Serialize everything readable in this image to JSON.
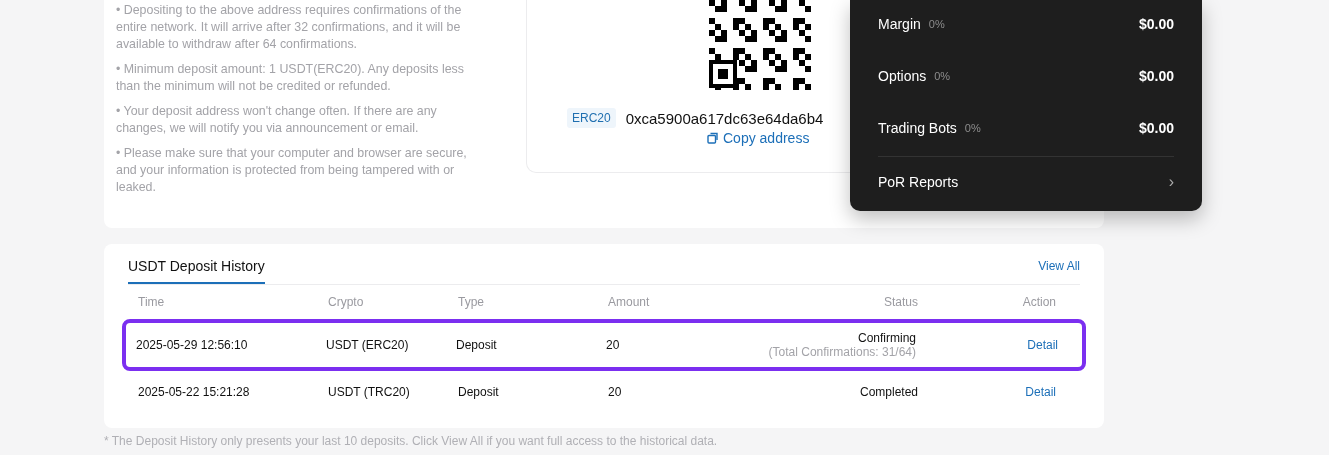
{
  "deposit_notes": [
    "• Depositing to the above address requires confirmations of the entire network. It will arrive after 32 confirmations, and it will be available to withdraw after 64 confirmations.",
    "• Minimum deposit amount: 1 USDT(ERC20). Any deposits less than the minimum will not be credited or refunded.",
    "• Your deposit address won't change often. If there are any changes, we will notify you via announcement or email.",
    "• Please make sure that your computer and browser are secure, and your information is protected from being tampered with or leaked."
  ],
  "address_card": {
    "network": "ERC20",
    "address": "0xca5900a617dc63e64da6b4",
    "copy_label": "Copy address"
  },
  "account_menu": {
    "items": [
      {
        "name": "Margin",
        "percent": "0%",
        "amount": "$0.00"
      },
      {
        "name": "Options",
        "percent": "0%",
        "amount": "$0.00"
      },
      {
        "name": "Trading Bots",
        "percent": "0%",
        "amount": "$0.00"
      }
    ],
    "link": "PoR Reports",
    "link_icon": "›"
  },
  "history": {
    "tab": "USDT Deposit History",
    "view_all": "View All",
    "columns": [
      "Time",
      "Crypto",
      "Type",
      "Amount",
      "Status",
      "Action"
    ],
    "rows": [
      {
        "time": "2025-05-29 12:56:10",
        "crypto": "USDT (ERC20)",
        "type": "Deposit",
        "amount": "20",
        "status": "Confirming",
        "status_detail": "(Total Confirmations: 31/64)",
        "action": "Detail",
        "selected": true
      },
      {
        "time": "2025-05-22 15:21:28",
        "crypto": "USDT (TRC20)",
        "type": "Deposit",
        "amount": "20",
        "status": "Completed",
        "action": "Detail",
        "selected": false
      }
    ]
  },
  "footnote": "* The Deposit History only presents your last 10 deposits. Click View All if you want full access to the historical data."
}
